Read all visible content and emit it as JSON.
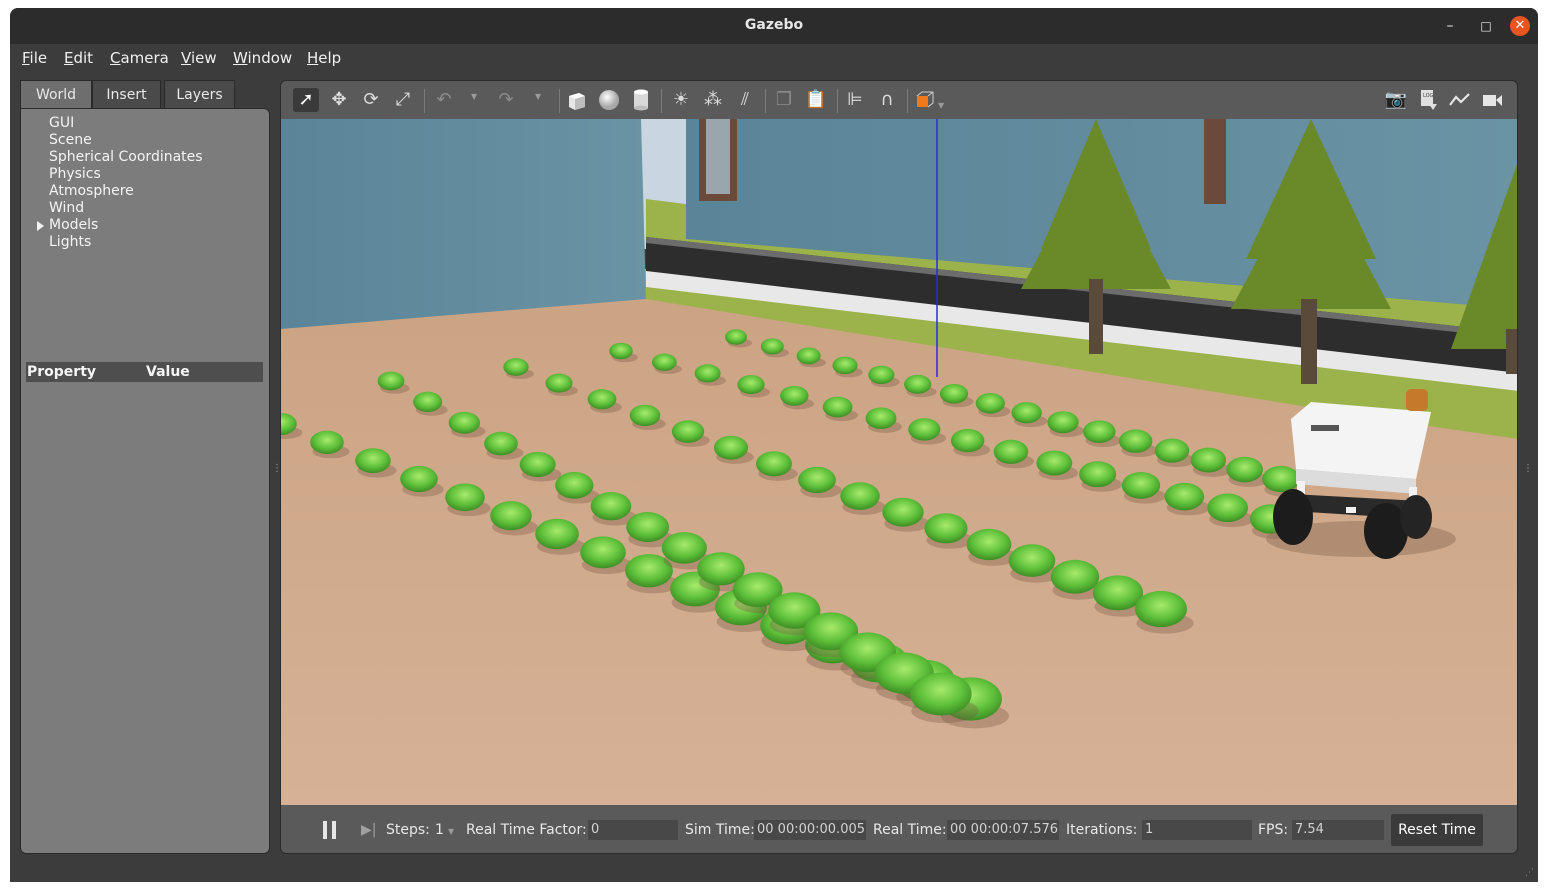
{
  "window": {
    "title": "Gazebo",
    "minimize": "–",
    "maximize": "□",
    "close": "✕"
  },
  "menu": [
    {
      "first": "F",
      "rest": "ile"
    },
    {
      "first": "E",
      "rest": "dit"
    },
    {
      "first": "C",
      "rest": "amera"
    },
    {
      "first": "V",
      "rest": "iew"
    },
    {
      "first": "W",
      "rest": "indow"
    },
    {
      "first": "H",
      "rest": "elp"
    }
  ],
  "left_panel": {
    "tabs": [
      "World",
      "Insert",
      "Layers"
    ],
    "active_tab": "World",
    "tree": [
      "GUI",
      "Scene",
      "Spherical Coordinates",
      "Physics",
      "Atmosphere",
      "Wind",
      "Models",
      "Lights"
    ],
    "property_header": {
      "property": "Property",
      "value": "Value"
    }
  },
  "toolbar": {
    "icons": [
      "select-mode-icon",
      "translate-icon",
      "rotate-icon",
      "scale-icon",
      "undo-icon",
      "redo-icon",
      "box-shape-icon",
      "sphere-shape-icon",
      "cylinder-shape-icon",
      "point-light-icon",
      "spot-light-icon",
      "directional-light-icon",
      "copy-icon",
      "paste-icon",
      "align-icon",
      "snap-icon",
      "view-angle-icon",
      "screenshot-icon",
      "log-icon",
      "plot-icon",
      "video-record-icon"
    ]
  },
  "scene": {
    "description_colors": {
      "soil": "#c9a27c",
      "wall": "#5f8aa0",
      "lettuce": "#5cbf3a",
      "grass": "#9cb24a",
      "robot_body": "#f2f2f2"
    }
  },
  "bottom_bar": {
    "steps_label": "Steps:",
    "steps_value": "1",
    "rtf_label": "Real Time Factor:",
    "rtf_value": "0",
    "sim_time_label": "Sim Time:",
    "sim_time_value": "00 00:00:00.005",
    "real_time_label": "Real Time:",
    "real_time_value": "00 00:00:07.576",
    "iterations_label": "Iterations:",
    "iterations_value": "1",
    "fps_label": "FPS:",
    "fps_value": "7.54",
    "reset_label": "Reset Time"
  }
}
